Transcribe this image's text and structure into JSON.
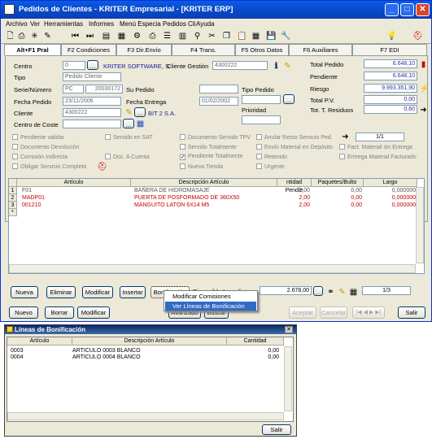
{
  "window": {
    "title": "Pedidos de Clientes - KRITER Empresarial - [KRITER ERP]"
  },
  "menu": [
    "Archivo",
    "Ver",
    "Herramientas",
    "Informes",
    "Menú Especia Pedidos Cli",
    "Ayuda"
  ],
  "tabs": [
    "Alt+F1 Pral",
    "F2 Condiciones",
    "F3 Dir.Envío",
    "F4 Trans.",
    "F5 Otros Datos",
    "F6 Auxiliares",
    "F7 EDI"
  ],
  "form": {
    "centro_label": "Centro",
    "centro_value": "0",
    "centro_name": "KRITER SOFTWARE, S.",
    "cliente_gestion_label": "Cliente Gestión",
    "cliente_gestion_value": "4300222",
    "tipo_label": "Tipo",
    "tipo_value": "Pedido Cliente",
    "serie_label": "Serie/Número",
    "serie_value": "PC",
    "numero_value": "20030172",
    "su_pedido_label": "Su Pedido",
    "tipo_pedido_label": "Tipo Pedido",
    "fecha_pedido_label": "Fecha Pedido",
    "fecha_pedido_value": "23/11/2006",
    "fecha_entrega_label": "Fecha Entrega",
    "fecha_entrega_value": "01/02/2002",
    "cliente_label": "Cliente",
    "cliente_value": "4300222",
    "cliente_name": "BIT 2 S.A.",
    "prioridad_label": "Prioridad",
    "centro_coste_label": "Centro de Coste"
  },
  "totals": [
    {
      "label": "Total Pedido",
      "value": "6.648,10"
    },
    {
      "label": "Pendiente",
      "value": "6.648,10"
    },
    {
      "label": "Riesgo",
      "value": "9.993.351,90"
    },
    {
      "label": "Total P.V.",
      "value": "0,00"
    },
    {
      "label": "Tot. T. Residuos",
      "value": "0,60"
    }
  ],
  "checks": [
    {
      "label": "Pendiente validar",
      "checked": false
    },
    {
      "label": "Servido en SAT",
      "checked": false
    },
    {
      "label": "Documento Servido TPV",
      "checked": false
    },
    {
      "label": "Anular Resto Servicio Ped.",
      "checked": false
    },
    {
      "label": "Documento Devolución",
      "checked": false
    },
    {
      "label": "Servido Totalmente",
      "checked": false
    },
    {
      "label": "Envío Material en Depósito",
      "checked": false
    },
    {
      "label": "Fact. Material sin Entrega",
      "checked": false
    },
    {
      "label": "Comisión Indirecta",
      "checked": false
    },
    {
      "label": "Doc. A Cuenta",
      "checked": false
    },
    {
      "label": "Pendiente Totalmente",
      "checked": true
    },
    {
      "label": "Retenido",
      "checked": false
    },
    {
      "label": "Entrega Material Facturado",
      "checked": false
    },
    {
      "label": "Obligar Servicio Completo",
      "checked": false
    },
    {
      "label": "Nueva Tienda",
      "checked": false
    },
    {
      "label": "Urgente",
      "checked": false
    }
  ],
  "pager": "1/1",
  "lines": {
    "columns": [
      "Artículo",
      "Descripción Artículo",
      "ntidad Pendie",
      "Paquetes/Bulto",
      "Largo"
    ],
    "rows": [
      {
        "n": "1",
        "articulo": "F01",
        "descripcion": "BAÑERA DE HIDROMASAJE",
        "cantidad": "2,00",
        "paquetes": "0,00",
        "largo": "0,000000"
      },
      {
        "n": "2",
        "articulo": "MADP01",
        "descripcion": "PUERTA DE POSFORMADO DE 360X50",
        "cantidad": "2,00",
        "paquetes": "0,00",
        "largo": "0,000000"
      },
      {
        "n": "3",
        "articulo": "001210",
        "descripcion": "MANGUITO LATÓN 6X14 M5",
        "cantidad": "2,00",
        "paquetes": "0,00",
        "largo": "0,000000"
      }
    ]
  },
  "line_buttons": {
    "nueva": "Nueva",
    "eliminar": "Eliminar",
    "modificar": "Modificar",
    "insertar": "Insertar",
    "bonificacion": "Bonificación",
    "disponible": "Disponible Inmediato",
    "disponible_value": "2.678,00",
    "page": "1/3"
  },
  "context_menu": {
    "item1": "Modificar Comisiones",
    "item2": "Ver Líneas de Bonificación"
  },
  "bottom_buttons": {
    "nuevo": "Nuevo",
    "borrar": "Borrar",
    "modificar": "Modificar",
    "avanzado": "Avanzado",
    "buscar": "Buscar",
    "aceptar": "Aceptar",
    "cancelar": "Cancelar",
    "salir": "Salir"
  },
  "bonif": {
    "title": "Líneas de Bonificación",
    "columns": [
      "Artículo",
      "Descripción Artículo",
      "Cantidad"
    ],
    "rows": [
      {
        "articulo": "0003",
        "descripcion": "ARTICULO 0003 BLANCO",
        "cantidad": "0,00"
      },
      {
        "articulo": "0004",
        "descripcion": "ARTICULO 0004 BLANCO",
        "cantidad": "0,00"
      }
    ],
    "salir": "Salir"
  }
}
